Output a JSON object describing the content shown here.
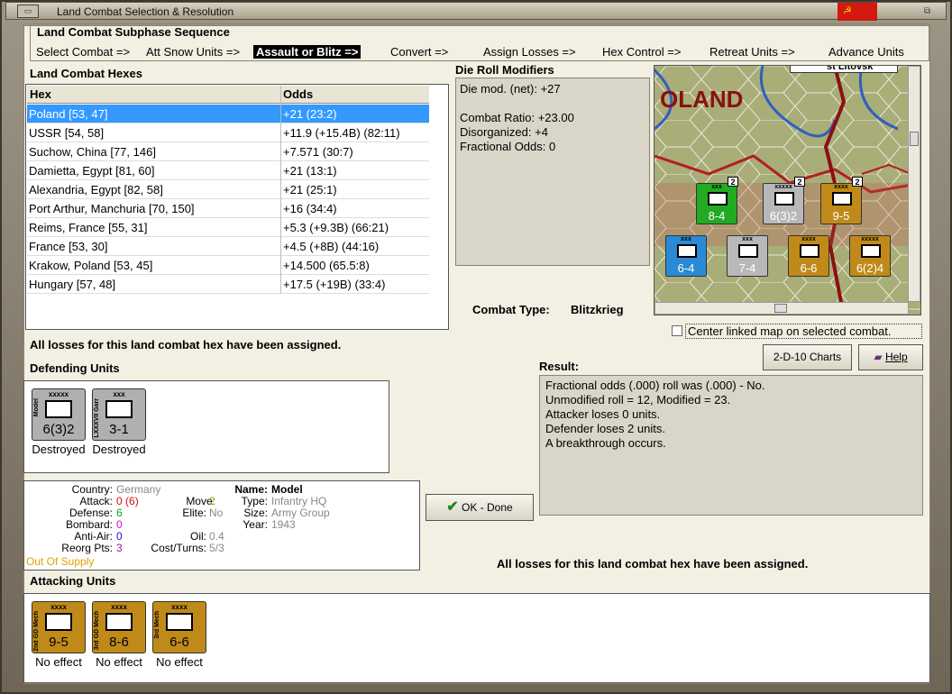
{
  "window": {
    "title": "Land Combat Selection & Resolution",
    "close_glyph": "☭"
  },
  "subphase": {
    "title": "Land Combat Subphase Sequence",
    "steps": [
      "Select Combat =>",
      "Att Snow Units =>",
      "Assault or Blitz =>",
      "Convert =>",
      "Assign Losses =>",
      "Hex Control =>",
      "Retreat Units =>",
      "Advance Units"
    ],
    "active_index": 2
  },
  "hexes": {
    "title": "Land Combat Hexes",
    "headers": [
      "Hex",
      "Odds"
    ],
    "rows": [
      [
        "Poland [53, 47]",
        "+21 (23:2)"
      ],
      [
        "USSR [54, 58]",
        "+11.9 (+15.4B) (82:11)"
      ],
      [
        "Suchow, China [77, 146]",
        "+7.571 (30:7)"
      ],
      [
        "Damietta, Egypt [81, 60]",
        "+21 (13:1)"
      ],
      [
        "Alexandria, Egypt [82, 58]",
        "+21 (25:1)"
      ],
      [
        "Port Arthur, Manchuria [70, 150]",
        "+16 (34:4)"
      ],
      [
        "Reims, France [55, 31]",
        "+5.3 (+9.3B) (66:21)"
      ],
      [
        "France [53, 30]",
        "+4.5 (+8B) (44:16)"
      ],
      [
        "Krakow, Poland [53, 45]",
        "+14.500 (65.5:8)"
      ],
      [
        "Hungary [57, 48]",
        "+17.5 (+19B) (33:4)"
      ]
    ],
    "selected_index": 0
  },
  "die_roll": {
    "title": "Die Roll Modifiers",
    "lines": [
      "Die mod. (net): +27",
      "",
      "Combat Ratio: +23.00",
      "Disorganized: +4",
      "Fractional Odds: 0"
    ]
  },
  "map": {
    "label": "OLAND",
    "top_label": "st Litovsk",
    "units": [
      {
        "text": "8-4",
        "color": "#22aa22",
        "size": "xxx",
        "stack": "2"
      },
      {
        "text": "6(3)2",
        "color": "#b8b8b8",
        "size": "xxxxx",
        "stack": "2"
      },
      {
        "text": "9-5",
        "color": "#c08a1a",
        "size": "xxxx",
        "stack": "2"
      },
      {
        "text": "6-4",
        "color": "#2a8ad6",
        "size": "xxx",
        "stack": ""
      },
      {
        "text": "7-4",
        "color": "#b8b8b8",
        "size": "xxx",
        "stack": ""
      },
      {
        "text": "6-6",
        "color": "#c08a1a",
        "size": "xxxx",
        "stack": ""
      },
      {
        "text": "6(2)4",
        "color": "#c08a1a",
        "size": "xxxxx",
        "stack": ""
      }
    ]
  },
  "combat_type": {
    "label": "Combat Type:",
    "value": "Blitzkrieg"
  },
  "center_map": {
    "label": "Center linked map on selected combat.",
    "checked": false
  },
  "losses_msg": "All losses for this land combat hex have been assigned.",
  "buttons": {
    "charts": "2-D-10 Charts",
    "help": "Help",
    "ok": "OK - Done"
  },
  "result": {
    "title": "Result:",
    "lines": [
      "Fractional odds (.000) roll was (.000)  - No.",
      "Unmodified roll = 12, Modified = 23.",
      "Attacker loses 0 units.",
      "Defender loses 2 units.",
      "A breakthrough occurs."
    ]
  },
  "defending": {
    "title": "Defending Units",
    "units": [
      {
        "name": "Model",
        "size": "xxxxx",
        "strength": "6(3)2",
        "status": "Destroyed",
        "color": "#b0b0b0"
      },
      {
        "name": "LXXXVII Garr",
        "size": "xxx",
        "strength": "3-1",
        "status": "Destroyed",
        "color": "#b0b0b0"
      }
    ]
  },
  "unit_info": {
    "country_label": "Country:",
    "country": "Germany",
    "attack_label": "Attack:",
    "attack": "0",
    "attack_paren": "(6)",
    "defense_label": "Defense:",
    "defense": "6",
    "bombard_label": "Bombard:",
    "bombard": "0",
    "antiair_label": "Anti-Air:",
    "antiair": "0",
    "reorg_label": "Reorg Pts:",
    "reorg": "3",
    "supply": "Out Of Supply",
    "move_label": "Move:",
    "move": "2",
    "elite_label": "Elite:",
    "elite": "No",
    "oil_label": "Oil:",
    "oil": "0.4",
    "cost_label": "Cost/Turns:",
    "cost": "5/3",
    "name_label": "Name:",
    "name": "Model",
    "type_label": "Type:",
    "type": "Infantry HQ",
    "size_label": "Size:",
    "size": "Army Group",
    "year_label": "Year:",
    "year": "1943"
  },
  "attacking": {
    "title": "Attacking Units",
    "units": [
      {
        "name": "2nd GD Mech",
        "size": "xxxx",
        "strength": "9-5",
        "status": "No effect",
        "color": "#c08a1a"
      },
      {
        "name": "3rd GD Mech",
        "size": "xxxx",
        "strength": "8-6",
        "status": "No effect",
        "color": "#c08a1a"
      },
      {
        "name": "3rd Mech",
        "size": "xxxx",
        "strength": "6-6",
        "status": "No effect",
        "color": "#c08a1a"
      }
    ]
  }
}
